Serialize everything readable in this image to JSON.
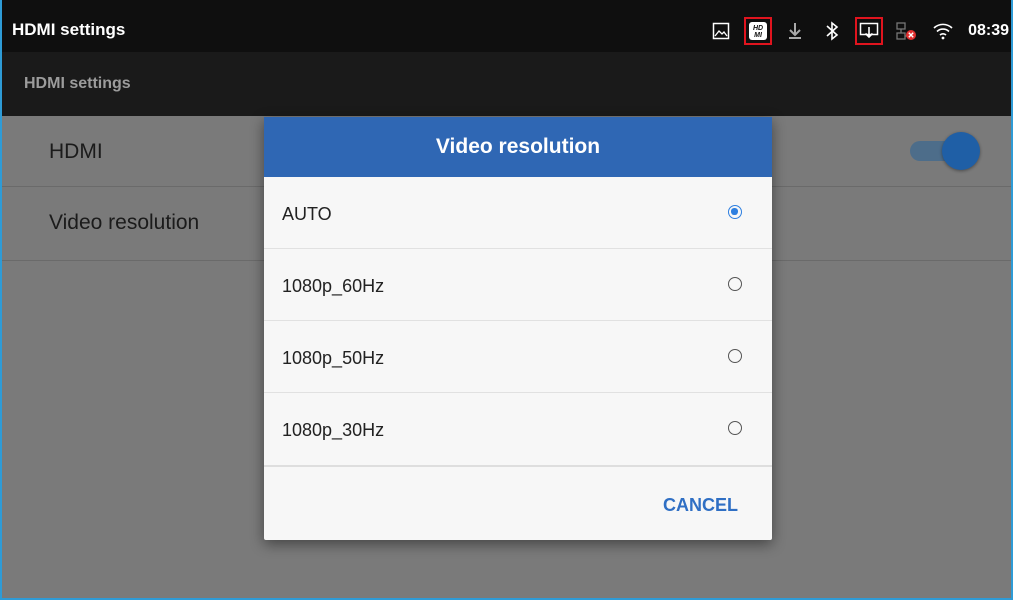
{
  "status_bar": {
    "title": "HDMI settings",
    "time": "08:39",
    "icons": [
      "screenshot-icon",
      "hdmi-icon",
      "download-icon",
      "bluetooth-icon",
      "screen-cast-icon",
      "network-disconnected-icon",
      "wifi-icon"
    ]
  },
  "app_bar": {
    "title": "HDMI settings"
  },
  "settings": {
    "hdmi_label": "HDMI",
    "hdmi_enabled": true,
    "video_resolution_label": "Video resolution"
  },
  "dialog": {
    "title": "Video resolution",
    "options": [
      {
        "label": "AUTO",
        "selected": true
      },
      {
        "label": "1080p_60Hz",
        "selected": false
      },
      {
        "label": "1080p_50Hz",
        "selected": false
      },
      {
        "label": "1080p_30Hz",
        "selected": false
      }
    ],
    "cancel_label": "CANCEL"
  },
  "colors": {
    "accent": "#2f67b4",
    "radio_selected": "#2e7fe0",
    "highlight_box": "#e0141e",
    "frame_border": "#2e9bd6"
  }
}
